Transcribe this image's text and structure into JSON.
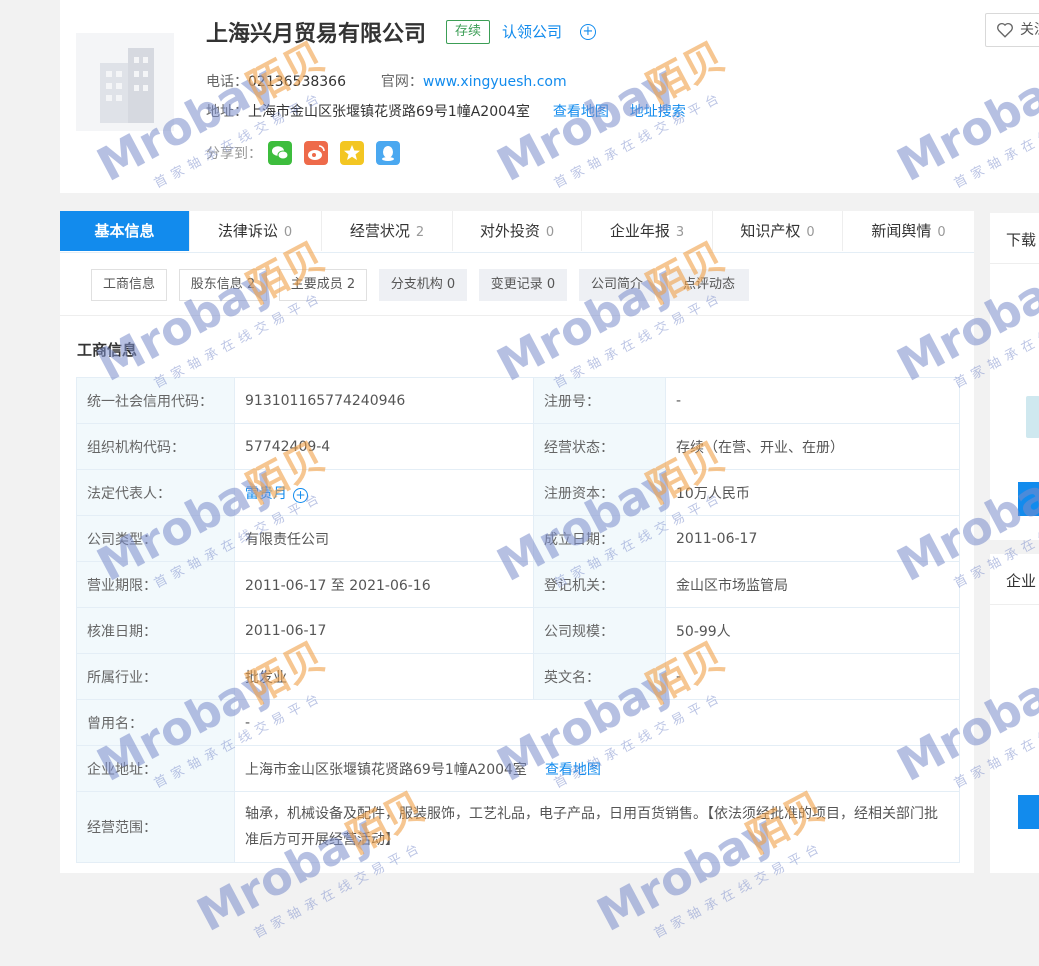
{
  "company": {
    "name": "上海兴月贸易有限公司",
    "status": "存续",
    "claim": "认领公司",
    "claim_plus": "+",
    "phone_label": "电话：",
    "phone": "02136538366",
    "website_label": "官网：",
    "website": "www.xingyuesh.com",
    "address_label": "地址：",
    "address": "上海市金山区张堰镇花贤路69号1幢A2004室",
    "view_map": "查看地图",
    "address_search": "地址搜索",
    "share_label": "分享到："
  },
  "follow_label": "关注",
  "tabs": [
    {
      "label": "基本信息",
      "count": ""
    },
    {
      "label": "法律诉讼",
      "count": "0"
    },
    {
      "label": "经营状况",
      "count": "2"
    },
    {
      "label": "对外投资",
      "count": "0"
    },
    {
      "label": "企业年报",
      "count": "3"
    },
    {
      "label": "知识产权",
      "count": "0"
    },
    {
      "label": "新闻舆情",
      "count": "0"
    }
  ],
  "subtabs": [
    {
      "label": "工商信息"
    },
    {
      "label": "股东信息 2"
    },
    {
      "label": "主要成员 2"
    },
    {
      "label": "分支机构 0"
    },
    {
      "label": "变更记录 0"
    },
    {
      "label": "公司简介"
    },
    {
      "label": "点评动态"
    }
  ],
  "section_title": "工商信息",
  "info": {
    "credit_code_label": "统一社会信用代码：",
    "credit_code": "913101165774240946",
    "reg_no_label": "注册号：",
    "reg_no": "-",
    "org_code_label": "组织机构代码：",
    "org_code": "57742409-4",
    "op_status_label": "经营状态：",
    "op_status": "存续（在营、开业、在册）",
    "legal_rep_label": "法定代表人：",
    "legal_rep": "雷贵月",
    "legal_plus": "+",
    "reg_capital_label": "注册资本：",
    "reg_capital": "10万人民币",
    "company_type_label": "公司类型：",
    "company_type": "有限责任公司",
    "found_date_label": "成立日期：",
    "found_date": "2011-06-17",
    "term_label": "营业期限：",
    "term": "2011-06-17 至 2021-06-16",
    "authority_label": "登记机关：",
    "authority": "金山区市场监管局",
    "approve_date_label": "核准日期：",
    "approve_date": "2011-06-17",
    "scale_label": "公司规模：",
    "scale": "50-99人",
    "industry_label": "所属行业：",
    "industry": "批发业",
    "en_name_label": "英文名：",
    "en_name": "-",
    "former_name_label": "曾用名：",
    "former_name": "-",
    "address_label": "企业地址：",
    "address": "上海市金山区张堰镇花贤路69号1幢A2004室",
    "view_map": "查看地图",
    "scope_label": "经营范围：",
    "scope": "轴承，机械设备及配件，服装服饰，工艺礼品，电子产品，日用百货销售。【依法须经批准的项目，经相关部门批准后方可开展经营活动】"
  },
  "right": {
    "download_title": "下载",
    "enterprise_title": "企业"
  },
  "watermark": {
    "brand": "Mrobay",
    "cn": "陌贝",
    "slogan": "首家轴承在线交易平台"
  },
  "colors": {
    "primary": "#128bed",
    "status_green": "#3c9e56",
    "watermark_blue": "#7a8ccb",
    "watermark_orange": "#f0a048"
  }
}
